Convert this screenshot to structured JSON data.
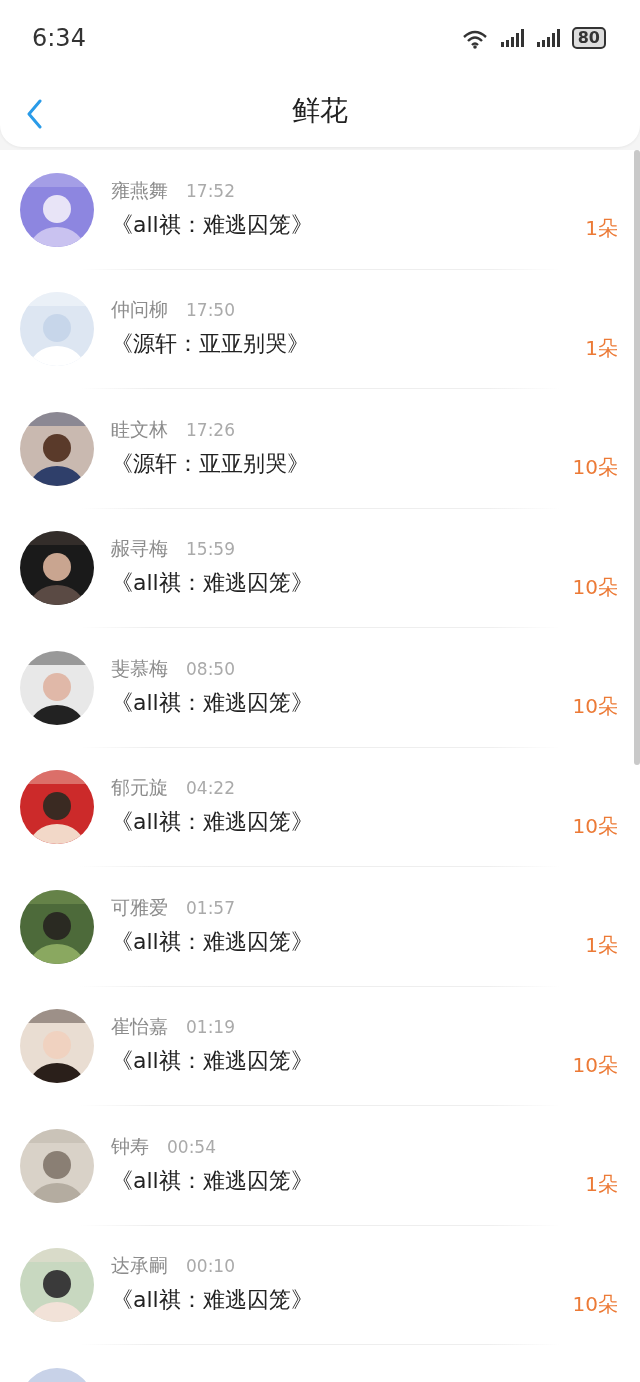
{
  "status_bar": {
    "time": "6:34",
    "battery": "80"
  },
  "nav": {
    "title": "鲜花"
  },
  "items": [
    {
      "name": "雍燕舞",
      "time": "17:52",
      "book": "《all祺：难逃囚笼》",
      "amount": "1朵"
    },
    {
      "name": "仲问柳",
      "time": "17:50",
      "book": "《源轩：亚亚别哭》",
      "amount": "1朵"
    },
    {
      "name": "眭文林",
      "time": "17:26",
      "book": "《源轩：亚亚别哭》",
      "amount": "10朵"
    },
    {
      "name": "赧寻梅",
      "time": "15:59",
      "book": "《all祺：难逃囚笼》",
      "amount": "10朵"
    },
    {
      "name": "斐慕梅",
      "time": "08:50",
      "book": "《all祺：难逃囚笼》",
      "amount": "10朵"
    },
    {
      "name": "郁元旋",
      "time": "04:22",
      "book": "《all祺：难逃囚笼》",
      "amount": "10朵"
    },
    {
      "name": "可雅爱",
      "time": "01:57",
      "book": "《all祺：难逃囚笼》",
      "amount": "1朵"
    },
    {
      "name": "崔怡嘉",
      "time": "01:19",
      "book": "《all祺：难逃囚笼》",
      "amount": "10朵"
    },
    {
      "name": "钟寿",
      "time": "00:54",
      "book": "《all祺：难逃囚笼》",
      "amount": "1朵"
    },
    {
      "name": "达承嗣",
      "time": "00:10",
      "book": "《all祺：难逃囚笼》",
      "amount": "10朵"
    }
  ]
}
